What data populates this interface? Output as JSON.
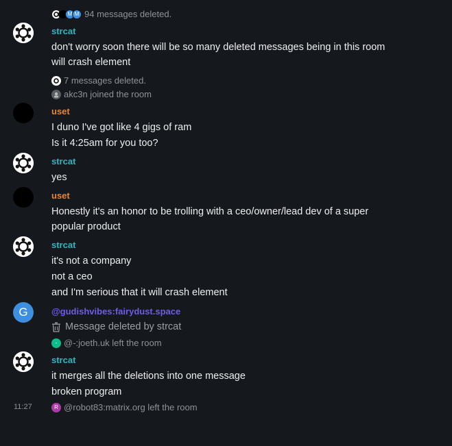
{
  "events": {
    "deleted_94": "94 messages deleted.",
    "deleted_7": "7 messages deleted.",
    "akc3n_join": "akc3n joined the room",
    "joeth_left": "@-:joeth.uk left the room",
    "robot_left": "@robot83:matrix.org left the room"
  },
  "avatars": {
    "m_letter": "M",
    "g_letter": "G",
    "dash_letter": "-",
    "r_letter": "R"
  },
  "messages": [
    {
      "sender": "strcat",
      "lines": [
        "don't worry soon there will be so many deleted messages being in this room",
        "will crash element"
      ]
    },
    {
      "sender": "uset",
      "lines": [
        "I duno I've got like 4 gigs of ram",
        "Is it 4:25am for you too?"
      ]
    },
    {
      "sender": "strcat",
      "lines": [
        "yes"
      ]
    },
    {
      "sender": "uset",
      "lines": [
        "Honestly it's an honor to be trolling with a ceo/owner/lead dev of a super",
        "popular product"
      ]
    },
    {
      "sender": "strcat",
      "lines": [
        "it's not a company",
        "not a ceo",
        "and I'm serious that it will crash element"
      ]
    },
    {
      "sender": "@gudishvibes:fairydust.space",
      "deleted_text": "Message deleted by strcat"
    },
    {
      "sender": "strcat",
      "lines": [
        "it merges all the deletions into one message",
        "broken program"
      ]
    }
  ],
  "timestamp": "11:27",
  "colors": {
    "background": "#15191e",
    "strcat": "#30b6c0",
    "uset": "#e0873c",
    "gudishvibes": "#6d5de8",
    "meta_text": "#8d9399"
  }
}
